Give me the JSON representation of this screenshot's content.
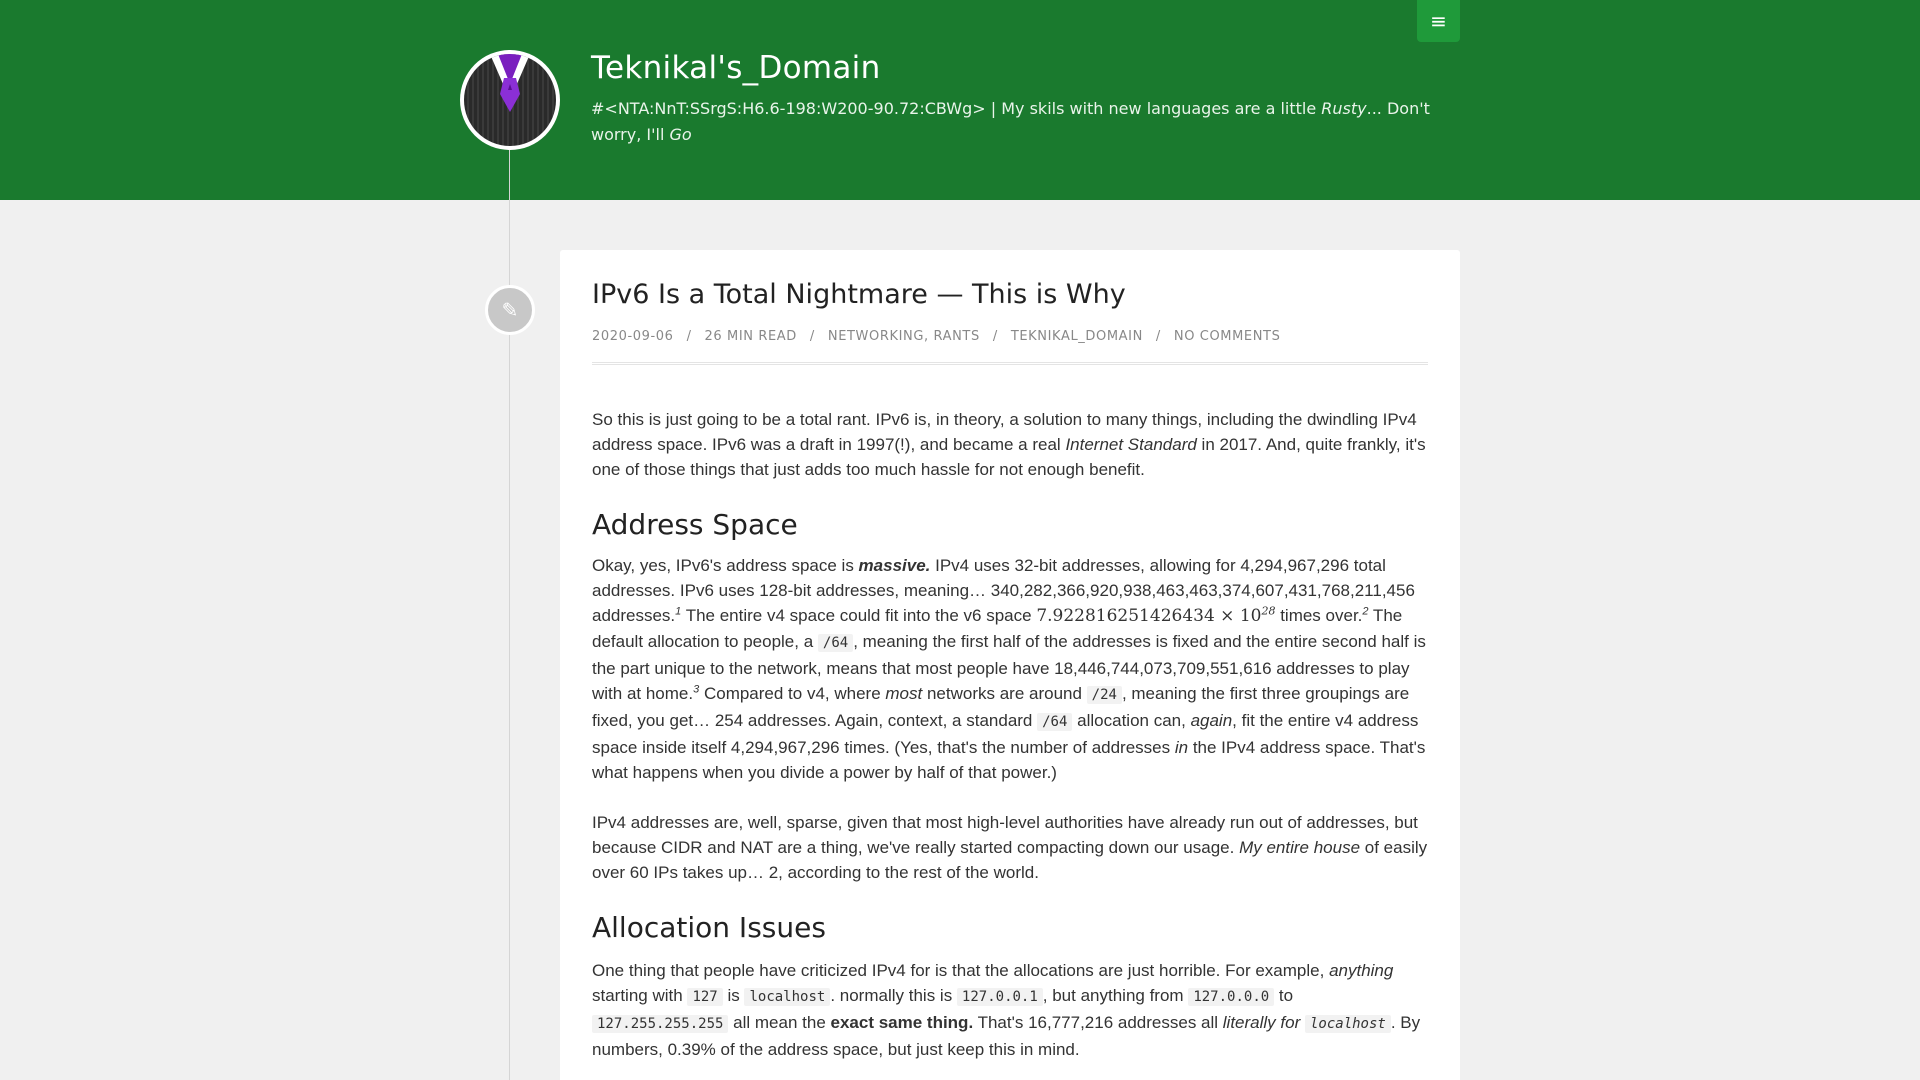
{
  "header": {
    "menu_icon": "hamburger-icon",
    "menu_glyph": "≡",
    "site_title": "Teknikal's_Domain",
    "desc_prefix": "#<NTA:NnT:SSrgS:H6.6-198:W200-90.72:CBWg> | My skils with new languages are a little ",
    "desc_rusty": "Rusty",
    "desc_mid": "... Don't worry, I'll ",
    "desc_go": "Go"
  },
  "post_marker_icon": "pencil-icon",
  "post_marker_glyph": "✎",
  "post": {
    "title": "IPv6 Is a Total Nightmare — This is Why",
    "date": "2020-09-06",
    "read_time": "26 min read",
    "cat1": "Networking",
    "cat_sep": ", ",
    "cat2": "Rants",
    "author": "Teknikal_Domain",
    "comments": "No Comments",
    "sep": "/"
  },
  "content": {
    "p1a": "So this is just going to be a total rant. IPv6 is, in theory, a solution to many things, including the dwindling IPv4 address space. IPv6 was a draft in 1997(!), and became a real ",
    "p1b": "Internet Standard",
    "p1c": " in 2017. And, quite frankly, it's one of those things that just adds too much hassle for not enough benefit.",
    "h_address": "Address Space",
    "p2a": "Okay, yes, IPv6's address space is ",
    "p2b": "massive.",
    "p2c": " IPv4 uses 32-bit addresses, allowing for 4,294,967,296 total addresses. IPv6 uses 128-bit addresses, meaning… 340,282,366,920,938,463,463,374,607,431,768,211,456 addresses.",
    "fn1": "1",
    "p2d": " The entire v4 space could fit into the v6 space ",
    "math_mant": "7.922816251426434 × 10",
    "math_exp": "28",
    "p2e": " times over.",
    "fn2": "2",
    "p2f": " The default allocation to people, a ",
    "code_64a": "/64",
    "p2g": ", meaning the first half of the addresses is fixed and the entire second half is the part unique to the network, means that most people have 18,446,744,073,709,551,616 addresses to play with at home.",
    "fn3": "3",
    "p2h": " Compared to v4, where ",
    "p2i": "most",
    "p2j": " networks are around ",
    "code_24": "/24",
    "p2k": ", meaning the first three groupings are fixed, you get… 254 addresses. Again, context, a standard ",
    "code_64b": "/64",
    "p2l": " allocation can, ",
    "p2m": "again",
    "p2n": ", fit the entire v4 address space inside itself 4,294,967,296 times. (Yes, that's the number of addresses ",
    "p2o": "in",
    "p2p": " the IPv4 address space. That's what happens when you divide a power by half of that power.)",
    "p3a": "IPv4 addresses are, well, sparse, given that most high-level authorities have already run out of addresses, but because CIDR and NAT are a thing, we've really started compacting down our usage. ",
    "p3b": "My entire house",
    "p3c": " of easily over 60 IPs takes up… 2, according to the rest of the world.",
    "h_alloc": "Allocation Issues",
    "p4a": "One thing that people have criticized IPv4 for is that the allocations are just horrible. For example, ",
    "p4b": "anything",
    "p4c": " starting with ",
    "code_127": "127",
    "p4d": " is ",
    "code_localhost": "localhost",
    "p4e": ". normally this is ",
    "code_127001": "127.0.0.1",
    "p4f": ", but anything from ",
    "code_127000": "127.0.0.0",
    "p4g": " to ",
    "code_127255": "127.255.255.255",
    "p4h": " all mean the ",
    "p4i": "exact same thing.",
    "p4j": " That's 16,777,216 addresses all ",
    "p4k": "literally for",
    "code_localhost2": "localhost",
    "p4l": ". By numbers, 0.39% of the address space, but just keep this in mind."
  }
}
